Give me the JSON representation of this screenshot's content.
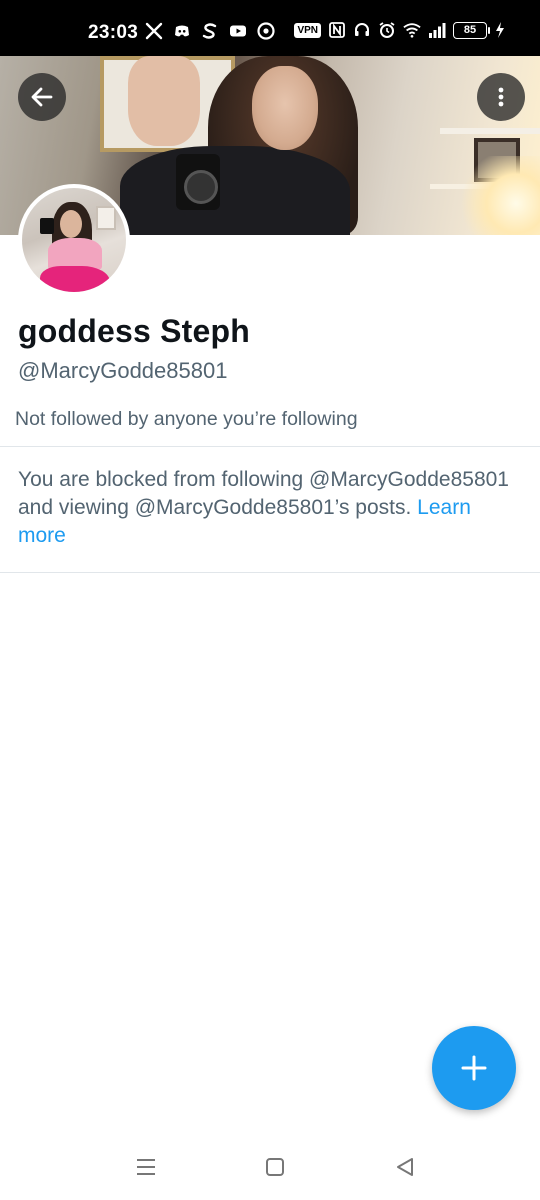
{
  "status_bar": {
    "time": "23:03",
    "left_icons": [
      "x-app-icon",
      "discord-icon",
      "s-app-icon",
      "youtube-icon",
      "chrome-icon"
    ],
    "right_icons": [
      "vpn-badge",
      "nfc-icon",
      "headphones-icon",
      "alarm-icon",
      "wifi-icon",
      "signal-icon",
      "battery-icon",
      "charging-icon"
    ],
    "vpn_label": "VPN",
    "battery_level": "85"
  },
  "header": {
    "back_icon": "arrow-left-icon",
    "more_icon": "more-vertical-icon"
  },
  "profile": {
    "display_name": "goddess Steph",
    "handle": "@MarcyGodde85801",
    "followed_by": "Not followed by anyone you’re following"
  },
  "blocked": {
    "message": "You are blocked from following @MarcyGodde85801 and viewing @MarcyGodde85801’s posts.",
    "link": "Learn more"
  },
  "fab": {
    "icon": "plus-icon"
  },
  "nav_bar": {
    "items": [
      "menu-icon",
      "home-square-icon",
      "back-triangle-icon"
    ]
  },
  "colors": {
    "accent": "#1d9bf0",
    "text_primary": "#0f1419",
    "text_secondary": "#536471",
    "divider": "#e1e6ea"
  }
}
